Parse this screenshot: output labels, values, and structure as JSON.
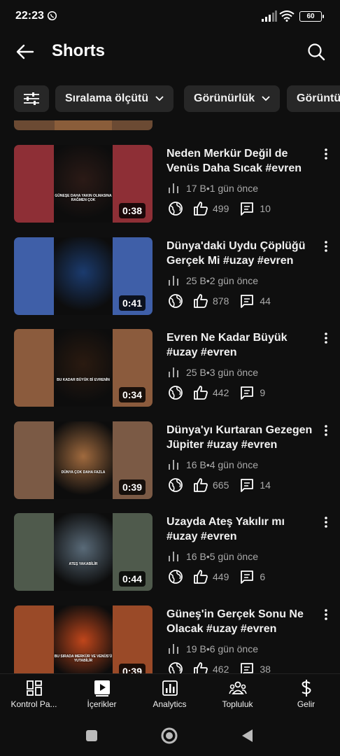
{
  "status_bar": {
    "time": "22:23",
    "battery": "60"
  },
  "header": {
    "title": "Shorts"
  },
  "filters": {
    "chips": [
      "Sıralama ölçütü",
      "Görünürlük",
      "Görüntü"
    ]
  },
  "videos": [
    {
      "title": "Neden Merkür Değil de Venüs Daha Sıcak  #evren",
      "views": "17 B",
      "age": "1 gün önce",
      "likes": "499",
      "comments": "10",
      "duration": "0:38",
      "caption": "GÜNEŞE DAHA YAKIN OLMASINA RAĞMEN ÇOK",
      "bg": "#8e2f36",
      "center": "#2b1a16"
    },
    {
      "title": "Dünya'daki Uydu Çöplüğü Gerçek Mi  #uzay #evren",
      "views": "25 B",
      "age": "2 gün önce",
      "likes": "878",
      "comments": "44",
      "duration": "0:41",
      "caption": "",
      "bg": "#3f5fa8",
      "center": "#1b3b6e"
    },
    {
      "title": "Evren Ne Kadar Büyük #uzay #evren",
      "views": "25 B",
      "age": "3 gün önce",
      "likes": "442",
      "comments": "9",
      "duration": "0:34",
      "caption": "BU KADAR BÜYÜK Bİ EVRENİN",
      "bg": "#8b5b3d",
      "center": "#2a1a10"
    },
    {
      "title": "Dünya'yı Kurtaran Gezegen Jüpiter  #uzay #evren",
      "views": "16 B",
      "age": "4 gün önce",
      "likes": "665",
      "comments": "14",
      "duration": "0:39",
      "caption": "DÜNYA ÇOK DAHA FAZLA",
      "bg": "#7b5a45",
      "center": "#a06a3e"
    },
    {
      "title": "Uzayda Ateş Yakılır mı #uzay #evren",
      "views": "16 B",
      "age": "5 gün önce",
      "likes": "449",
      "comments": "6",
      "duration": "0:44",
      "caption": "ATEŞ YAKABİLİR",
      "bg": "#4f5a4c",
      "center": "#596a78"
    },
    {
      "title": "Güneş'in Gerçek Sonu Ne Olacak  #uzay #evren",
      "views": "19 B",
      "age": "6 gün önce",
      "likes": "462",
      "comments": "38",
      "duration": "0:39",
      "caption": "BU SIRADA MERKÜR VE VENÜS'Ü YUTABİLİR",
      "bg": "#9a4a28",
      "center": "#c0461b"
    }
  ],
  "meta_separator": " • ",
  "bottom_nav": [
    {
      "label": "Kontrol Pa...",
      "icon": "dashboard-icon"
    },
    {
      "label": "İçerikler",
      "icon": "content-icon"
    },
    {
      "label": "Analytics",
      "icon": "analytics-icon"
    },
    {
      "label": "Topluluk",
      "icon": "community-icon"
    },
    {
      "label": "Gelir",
      "icon": "earn-icon"
    }
  ],
  "colors": {
    "background": "#0f0f0f",
    "chip": "#272727",
    "text": "#f1f1f1",
    "muted": "#aaaaaa"
  }
}
